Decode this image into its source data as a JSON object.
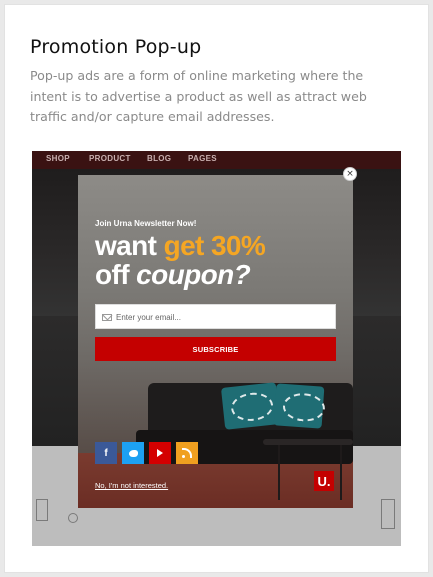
{
  "section": {
    "title": "Promotion Pop-up",
    "description": "Pop-up ads are a form of online marketing where the intent is to advertise a product as well as attract web traffic and/or capture email addresses."
  },
  "site_nav": {
    "items": [
      "SHOP",
      "PRODUCT",
      "BLOG",
      "PAGES"
    ]
  },
  "popup": {
    "kicker": "Join Urna Newsletter Now!",
    "headline_part1": "want ",
    "headline_highlight": "get 30%",
    "headline_part2": "off ",
    "headline_italic": "coupon?",
    "email_placeholder": "Enter your email...",
    "subscribe_label": "SUBSCRIBE",
    "no_thanks_label": "No, I'm not interested.",
    "logo_text": "U.",
    "close_symbol": "×",
    "social": [
      {
        "name": "facebook",
        "glyph": "f",
        "icon": "facebook-icon"
      },
      {
        "name": "twitter",
        "icon": "twitter-icon"
      },
      {
        "name": "youtube",
        "icon": "youtube-icon"
      },
      {
        "name": "rss",
        "icon": "rss-icon"
      }
    ]
  },
  "colors": {
    "accent_orange": "#f5a623",
    "brand_red": "#c40000",
    "facebook": "#3b5998",
    "twitter": "#1da1f2",
    "youtube": "#d40000",
    "rss": "#f0a020"
  }
}
